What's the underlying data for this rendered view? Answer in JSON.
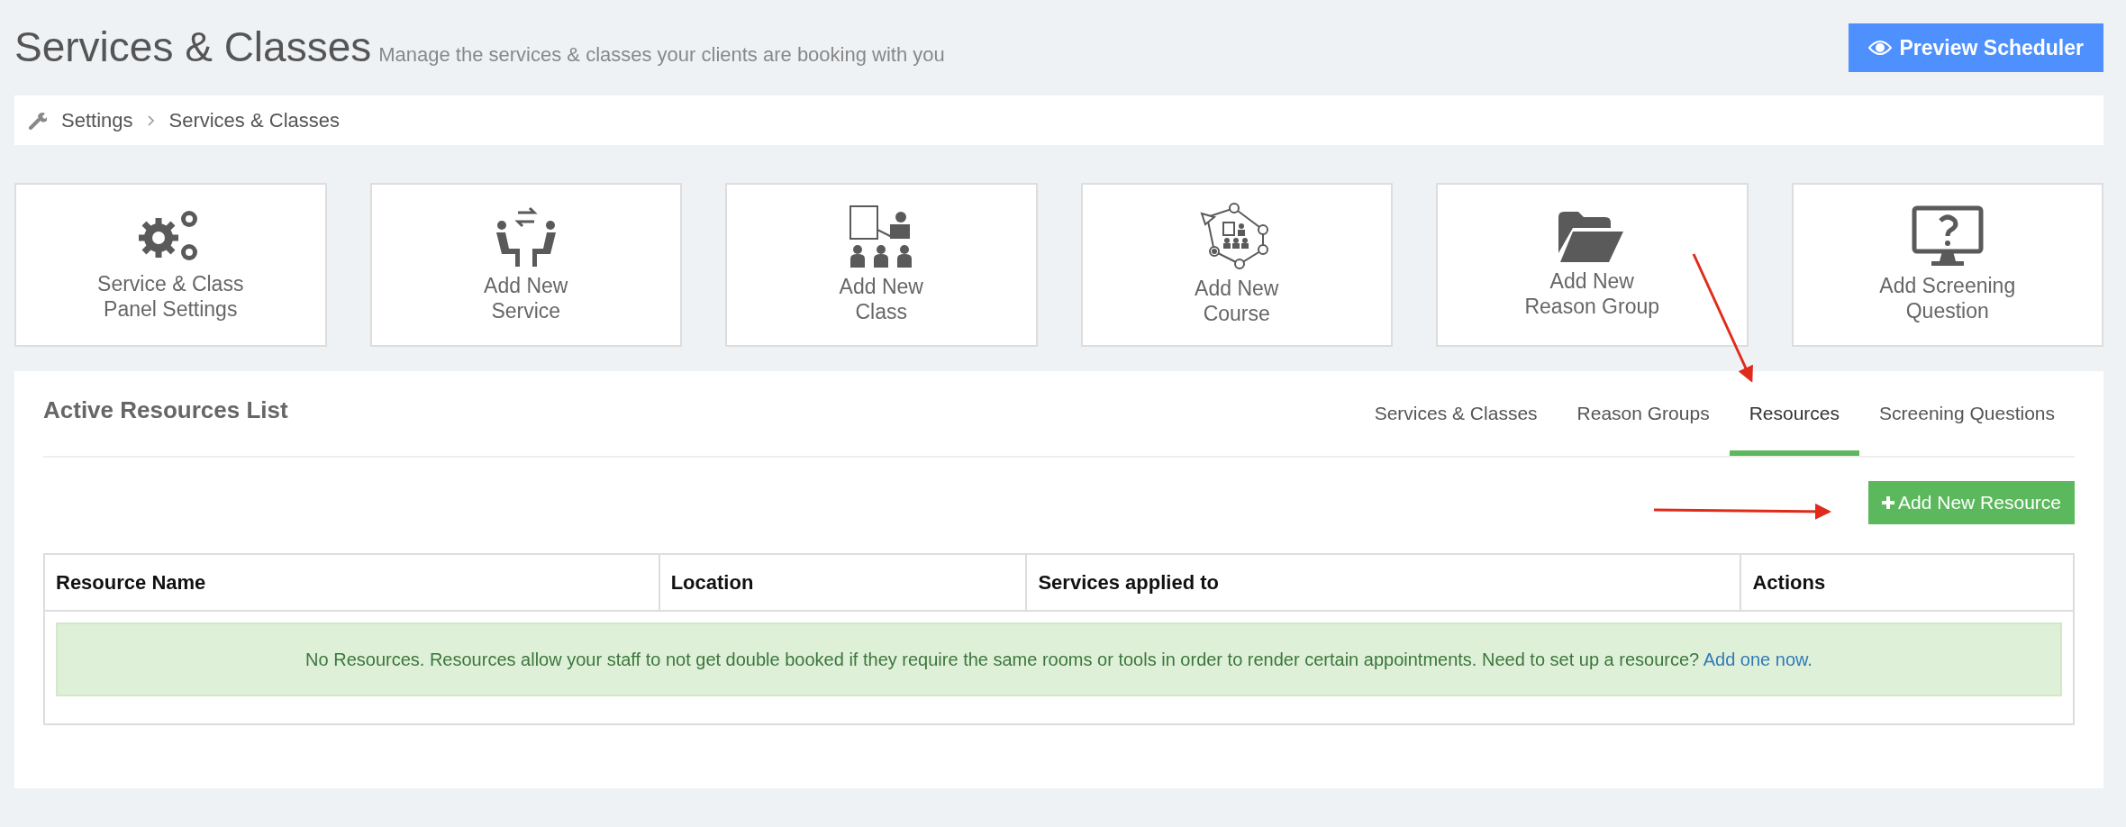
{
  "header": {
    "title": "Services & Classes",
    "subtitle": "Manage the services & classes your clients are booking with you",
    "preview_button": "Preview Scheduler"
  },
  "breadcrumb": [
    "Settings",
    "Services & Classes"
  ],
  "action_cards": [
    {
      "label": [
        "Service & Class",
        "Panel Settings"
      ]
    },
    {
      "label": [
        "Add New",
        "Service"
      ]
    },
    {
      "label": [
        "Add New",
        "Class"
      ]
    },
    {
      "label": [
        "Add New",
        "Course"
      ]
    },
    {
      "label": [
        "Add New",
        "Reason Group"
      ]
    },
    {
      "label": [
        "Add Screening",
        "Question"
      ]
    }
  ],
  "panel": {
    "title": "Active Resources List",
    "tabs": [
      {
        "label": "Services & Classes",
        "selected": false
      },
      {
        "label": "Reason Groups",
        "selected": false
      },
      {
        "label": "Resources",
        "selected": true
      },
      {
        "label": "Screening Questions",
        "selected": false
      }
    ],
    "add_button": "Add New Resource",
    "table": {
      "columns": [
        "Resource Name",
        "Location",
        "Services applied to",
        "Actions"
      ],
      "empty_message": {
        "text": "No Resources. Resources allow your staff to not get double booked if they require the same rooms or tools in order to render certain appointments. Need to set up a resource?",
        "link": "Add one now."
      }
    }
  }
}
